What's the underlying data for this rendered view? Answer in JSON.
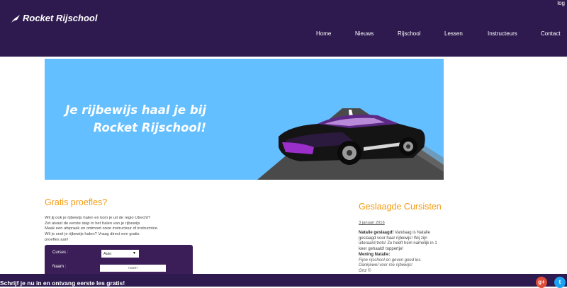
{
  "header": {
    "brand": "Rocket Rijschool",
    "login_label": "log",
    "nav": [
      "Home",
      "Nieuws",
      "Rijschool",
      "Lessen",
      "Instructeurs",
      "Contact"
    ]
  },
  "hero": {
    "line1": "Je rijbewijs haal je bij",
    "line2": "Rocket Rijschool!"
  },
  "proefles": {
    "title": "Gratis proefles?",
    "intro": [
      "Wil jij ook je rijbewijs halen en kom je uit de regio Utrecht?",
      "Zet alvast de eerste stap in het halen van je rijbewijs",
      "Maak een afspraak en ontmoet onze instructeur of instructrice.",
      "Wil je snel je rijbewijs halen? Vraag direct een gratis",
      "proefles aan!"
    ],
    "form": {
      "curses_label": "Curses :",
      "curses_value": "Auto",
      "naam_label": "Naam :",
      "naam_placeholder": "naam"
    }
  },
  "geslaagde": {
    "title": "Geslaagde Cursisten",
    "date": "3 januari 2016",
    "headline": "Natalie geslaagd!",
    "text1": " Vandaag is Natalie geslaagd voor haar rijbewijs! Wij zijn uiteraard trots! Ze heeft hem namelijk in 1 keer gehaald! toppertje!",
    "mening_label": "Mening Natalie:",
    "quote1": "Fijne rijschool en geven goed les.",
    "quote2": "Dankjewel voor me rijbewijs!",
    "quote3": "Grtz ©"
  },
  "footer": {
    "text": "Schrijf je nu in en ontvang eerste les gratis!",
    "gplus": "g+",
    "twitter": "t"
  },
  "colors": {
    "header_bg": "#2e1a4e",
    "hero_bg": "#63bfff",
    "accent": "#f39c12",
    "form_bg": "#3b1e57"
  }
}
